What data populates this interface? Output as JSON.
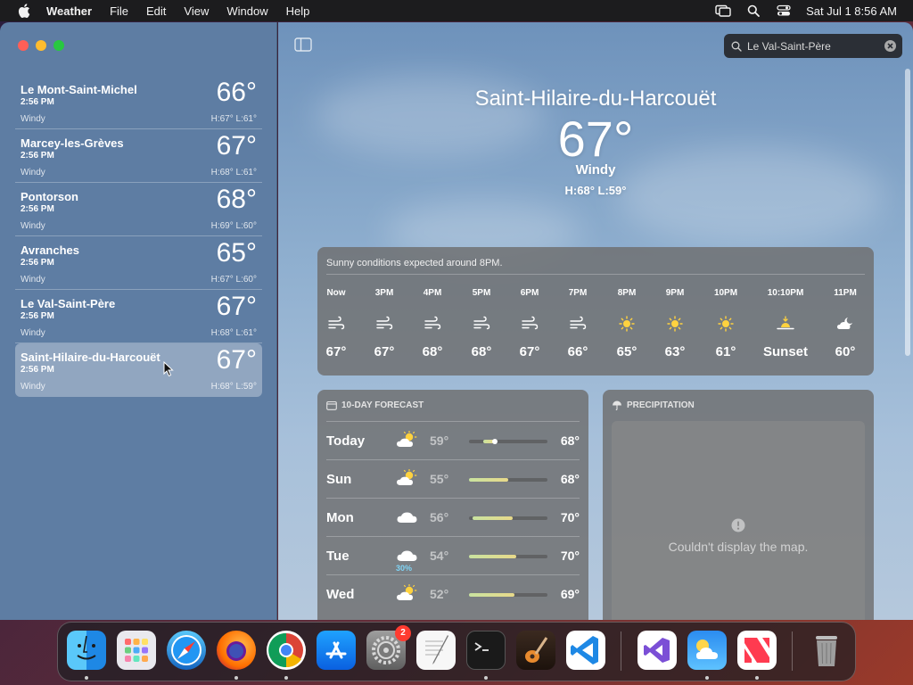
{
  "menubar": {
    "app_name": "Weather",
    "menus": [
      "File",
      "Edit",
      "View",
      "Window",
      "Help"
    ],
    "clock": "Sat Jul 1  8:56 AM"
  },
  "sidebar": {
    "locations": [
      {
        "name": "Le Mont-Saint-Michel",
        "time": "2:56 PM",
        "temp": "66°",
        "condition": "Windy",
        "hl": "H:67°  L:61°"
      },
      {
        "name": "Marcey-les-Grèves",
        "time": "2:56 PM",
        "temp": "67°",
        "condition": "Windy",
        "hl": "H:68°  L:61°"
      },
      {
        "name": "Pontorson",
        "time": "2:56 PM",
        "temp": "68°",
        "condition": "Windy",
        "hl": "H:69°  L:60°"
      },
      {
        "name": "Avranches",
        "time": "2:56 PM",
        "temp": "65°",
        "condition": "Windy",
        "hl": "H:67°  L:60°"
      },
      {
        "name": "Le Val-Saint-Père",
        "time": "2:56 PM",
        "temp": "67°",
        "condition": "Windy",
        "hl": "H:68°  L:61°"
      },
      {
        "name": "Saint-Hilaire-du-Harcouët",
        "time": "2:56 PM",
        "temp": "67°",
        "condition": "Windy",
        "hl": "H:68°  L:59°"
      }
    ]
  },
  "search": {
    "value": "Le Val-Saint-Père"
  },
  "hero": {
    "city": "Saint-Hilaire-du-Harcouët",
    "temp": "67°",
    "condition": "Windy",
    "hl": "H:68°  L:59°"
  },
  "hourly": {
    "summary": "Sunny conditions expected around 8PM.",
    "hours": [
      {
        "label": "Now",
        "icon": "wind-icon",
        "temp": "67°"
      },
      {
        "label": "3PM",
        "icon": "wind-icon",
        "temp": "67°"
      },
      {
        "label": "4PM",
        "icon": "wind-icon",
        "temp": "68°"
      },
      {
        "label": "5PM",
        "icon": "wind-icon",
        "temp": "68°"
      },
      {
        "label": "6PM",
        "icon": "wind-icon",
        "temp": "67°"
      },
      {
        "label": "7PM",
        "icon": "wind-icon",
        "temp": "66°"
      },
      {
        "label": "8PM",
        "icon": "sun-icon",
        "temp": "65°"
      },
      {
        "label": "9PM",
        "icon": "sun-icon",
        "temp": "63°"
      },
      {
        "label": "10PM",
        "icon": "sun-icon",
        "temp": "61°"
      },
      {
        "label": "10:10PM",
        "icon": "sunset-icon",
        "temp": "Sunset"
      },
      {
        "label": "11PM",
        "icon": "partly-cloudy-night-icon",
        "temp": "60°"
      }
    ]
  },
  "forecast": {
    "title": "10-DAY FORECAST",
    "days": [
      {
        "day": "Today",
        "icon": "partly-sunny-icon",
        "pop": "",
        "low": "59°",
        "high": "68°",
        "low_f": 0.18,
        "high_f": 0.32,
        "current_f": 0.3
      },
      {
        "day": "Sun",
        "icon": "partly-sunny-icon",
        "pop": "",
        "low": "55°",
        "high": "68°",
        "low_f": 0.0,
        "high_f": 0.5
      },
      {
        "day": "Mon",
        "icon": "cloud-icon",
        "pop": "",
        "low": "56°",
        "high": "70°",
        "low_f": 0.05,
        "high_f": 0.56
      },
      {
        "day": "Tue",
        "icon": "cloud-icon",
        "pop": "30%",
        "low": "54°",
        "high": "70°",
        "low_f": 0.0,
        "high_f": 0.6
      },
      {
        "day": "Wed",
        "icon": "partly-sunny-icon",
        "pop": "",
        "low": "52°",
        "high": "69°",
        "low_f": 0.0,
        "high_f": 0.58
      }
    ]
  },
  "precipitation": {
    "title": "PRECIPITATION",
    "message": "Couldn't display the map."
  },
  "dock": {
    "apps": [
      "Finder",
      "Launchpad",
      "Safari",
      "Firefox",
      "Chrome",
      "App Store",
      "System Settings",
      "TextEdit",
      "Terminal",
      "GarageBand",
      "VS Code",
      "Visual Studio",
      "Weather",
      "News",
      "Trash"
    ],
    "settings_badge": "2"
  }
}
